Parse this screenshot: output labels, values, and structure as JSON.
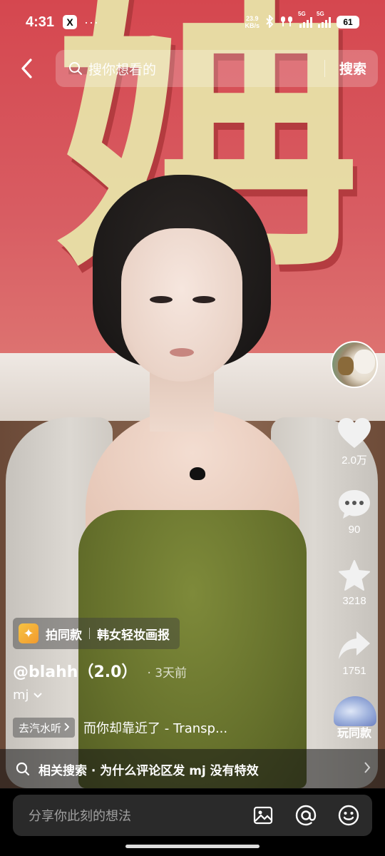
{
  "status_bar": {
    "time": "4:31",
    "app_badge": "X",
    "more": "···",
    "net_speed_value": "23.9",
    "net_speed_unit": "KB/s",
    "signal1_label": "5G",
    "signal2_label": "5G",
    "battery": "61"
  },
  "header": {
    "search_placeholder": "搜你想看的",
    "search_button": "搜索"
  },
  "rail": {
    "like_count": "2.0万",
    "comment_count": "90",
    "favorite_count": "3218",
    "share_count": "1751",
    "remix_label": "玩同款"
  },
  "info": {
    "effect_label": "拍同款",
    "effect_name": "韩女轻妆画报",
    "author": "@blahh（2.0）",
    "post_time": "· 3天前",
    "description": "mj",
    "music_tag": "去汽水听",
    "music_title": "而你却靠近了 - Transp..."
  },
  "related": {
    "text": "相关搜索 · 为什么评论区发 mj 没有特效"
  },
  "comment_bar": {
    "placeholder": "分享你此刻的想法"
  },
  "colors": {
    "accent_effect": "#f6c343",
    "input_bg": "#2a2a2a"
  }
}
